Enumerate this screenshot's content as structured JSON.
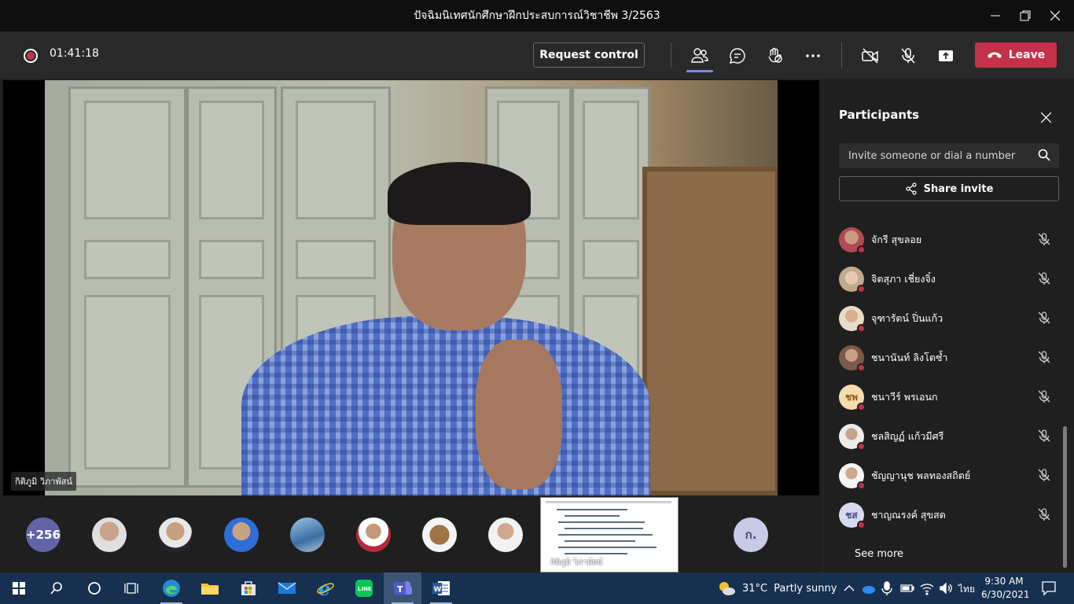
{
  "window": {
    "title": "ปัจฉิมนิเทศนักศึกษาฝึกประสบการณ์วิชาชีพ 3/2563"
  },
  "toolbar": {
    "timer": "01:41:18",
    "request_control": "Request control",
    "leave": "Leave"
  },
  "stage": {
    "speaker_name": "กิติภูมิ วิภาพัสน์"
  },
  "strip": {
    "overflow_count": "+256",
    "last_initials": "ก.",
    "share_caption": "กิติภูมิ วิภาพัสน์"
  },
  "participants": {
    "title": "Participants",
    "invite_placeholder": "Invite someone or dial a number",
    "share_invite": "Share invite",
    "see_more": "See more",
    "list": [
      {
        "name": "จักรี สุขลอย",
        "initials": "",
        "color": "#b46a6a"
      },
      {
        "name": "จิตสุภา เชี่ยงจิ๋ง",
        "initials": "",
        "color": "#d9b9a5"
      },
      {
        "name": "จุฑารัตน์ ปิ่นแก้ว",
        "initials": "",
        "color": "#c7a07a"
      },
      {
        "name": "ชนานันท์ ลิงโตซ้ำ",
        "initials": "",
        "color": "#9a7a6a"
      },
      {
        "name": "ชนาวีร์ พรเอนก",
        "initials": "ชพ",
        "color": "#f5dcae"
      },
      {
        "name": "ชลสิญฏ์ แก้วมีศรี",
        "initials": "",
        "color": "#c9c2b8"
      },
      {
        "name": "ชัญญานุช พลทองสถิตย์",
        "initials": "",
        "color": "#e6e0d6"
      },
      {
        "name": "ชาญณรงค์ สุขสด",
        "initials": "ชส",
        "color": "#d9d9ef"
      }
    ]
  },
  "taskbar": {
    "temperature": "31°C",
    "weather": "Partly sunny",
    "language": "ไทย",
    "time": "9:30 AM",
    "date": "6/30/2021"
  }
}
